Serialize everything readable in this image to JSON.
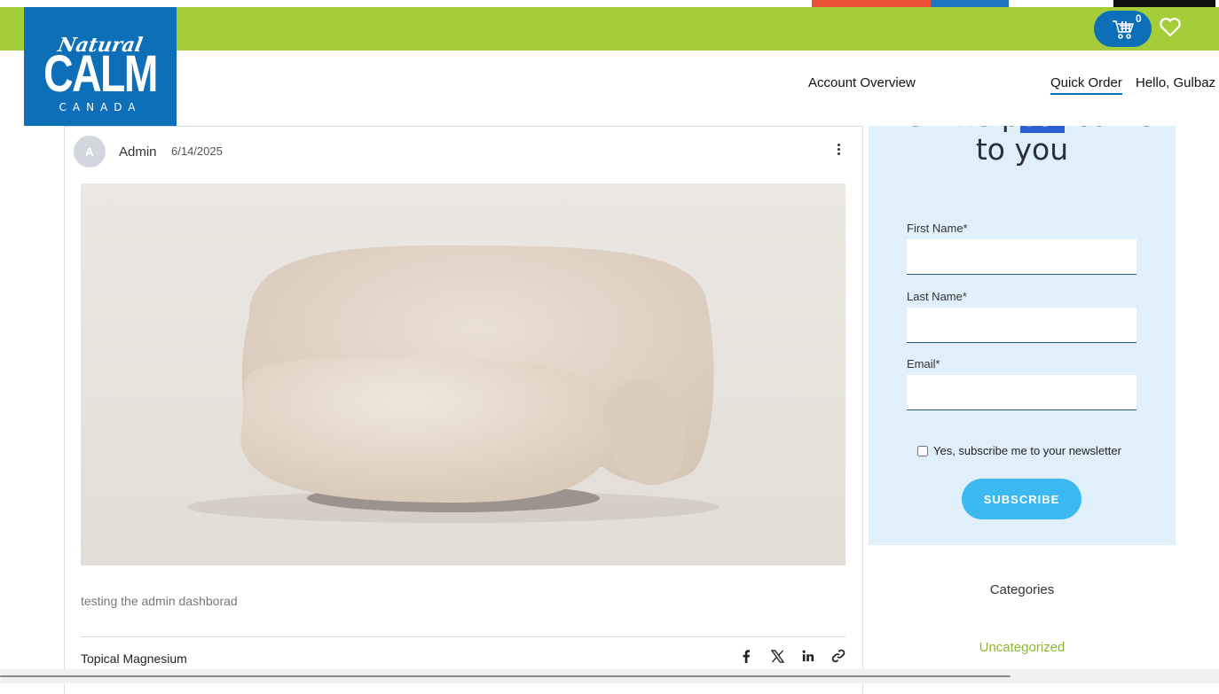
{
  "header": {
    "logo": {
      "script_text": "Natural",
      "word": "CALM",
      "sub": "CANADA"
    },
    "cart": {
      "count": "0",
      "icon": "cart-icon"
    },
    "wishlist_icon": "heart-icon",
    "nav": {
      "account_overview": "Account Overview",
      "quick_order": "Quick Order",
      "greeting": "Hello, Gulbaz"
    },
    "colors": {
      "green": "#a4cd39",
      "blue": "#0d6fb8",
      "red": "#ea5036"
    }
  },
  "post": {
    "avatar_initial": "A",
    "author": "Admin",
    "date": "6/14/2025",
    "more_icon": "more-vertical-icon",
    "image_alt": "beige sofa product photo",
    "excerpt": "testing the admin dashborad",
    "category": "Topical Magnesium",
    "share_icons": [
      "facebook-icon",
      "x-icon",
      "linkedin-icon",
      "link-icon"
    ]
  },
  "newsletter": {
    "title_part1": "Let the p",
    "title_highlight": "ost",
    "title_part2": " come",
    "title_line2": "to you",
    "first_name_label": "First Name*",
    "last_name_label": "Last Name*",
    "email_label": "Email*",
    "checkbox_label": "Yes, subscribe me to your newsletter",
    "subscribe_label": "SUBSCRIBE"
  },
  "sidebar": {
    "categories_title": "Categories",
    "categories": [
      "Uncategorized"
    ]
  }
}
